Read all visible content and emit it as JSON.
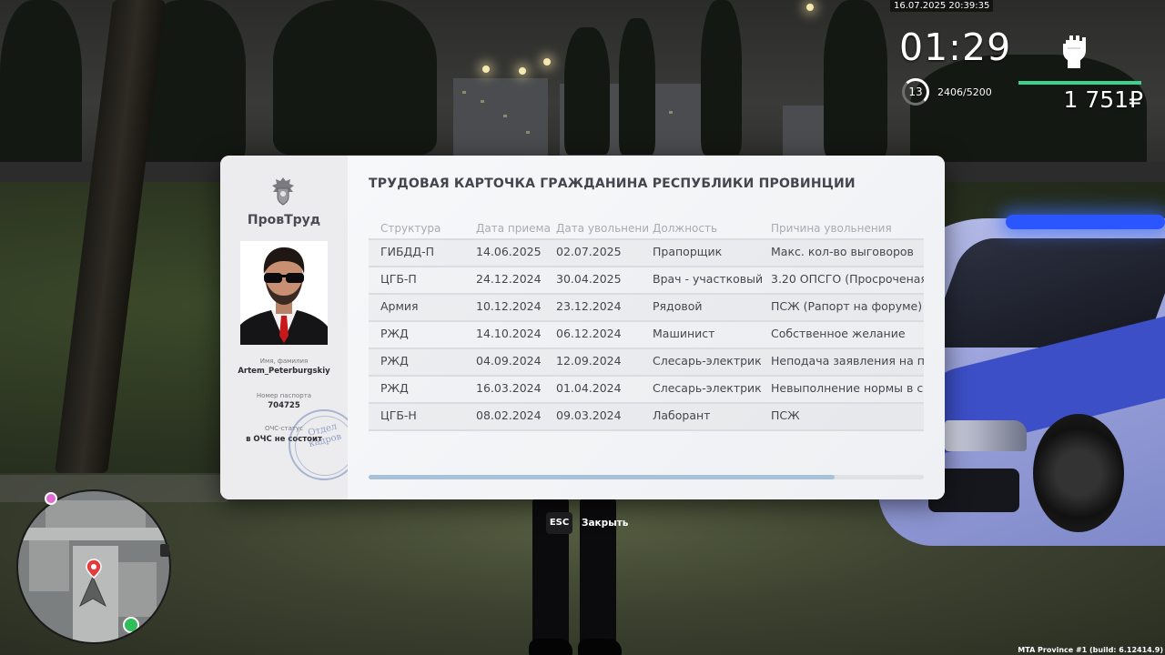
{
  "hud": {
    "datetime": "16.07.2025 20:39:35",
    "clock": "01:29",
    "level": "13",
    "xp": "2406/5200",
    "health_fraction": 1.0,
    "money": "1 751₽",
    "power_icon": "raised-fist-icon"
  },
  "card": {
    "org_name": "ПровТруд",
    "emblem_icon": "coat-of-arms-icon",
    "name_label": "Имя, фамилия",
    "name_value": "Artem_Peterburgskiy",
    "passport_label": "Номер паспорта",
    "passport_value": "704725",
    "ochs_label": "ОЧС-статус",
    "ochs_value": "в ОЧС не состоит",
    "stamp_text_1": "Отдел",
    "stamp_text_2": "кадров",
    "title": "ТРУДОВАЯ КАРТОЧКА ГРАЖДАНИНА РЕСПУБЛИКИ ПРОВИНЦИИ",
    "columns": [
      "Структура",
      "Дата приема",
      "Дата увольнени",
      "Должность",
      "Причина увольнения"
    ],
    "rows": [
      [
        "ГИБДД-П",
        "14.06.2025",
        "02.07.2025",
        "Прапорщик",
        "Макс. кол-во выговоров"
      ],
      [
        "ЦГБ-П",
        "24.12.2024",
        "30.04.2025",
        "Врач - участковый",
        "3.20 ОПСГО (Просроченая"
      ],
      [
        "Армия",
        "10.12.2024",
        "23.12.2024",
        "Рядовой",
        "ПСЖ (Рапорт на форуме)"
      ],
      [
        "РЖД",
        "14.10.2024",
        "06.12.2024",
        "Машинист",
        "Собственное желание"
      ],
      [
        "РЖД",
        "04.09.2024",
        "12.09.2024",
        "Слесарь-электрик",
        "Неподача заявления на повы"
      ],
      [
        "РЖД",
        "16.03.2024",
        "01.04.2024",
        "Слесарь-электрик",
        "Невыполнение нормы в срок"
      ],
      [
        "ЦГБ-Н",
        "08.02.2024",
        "09.03.2024",
        "Лаборант",
        "ПСЖ"
      ]
    ],
    "scroll_fraction": 0.84
  },
  "hint": {
    "key": "ESC",
    "label": "Закрыть"
  },
  "build_info": "MTA Province #1 (build: 6.12414.9)",
  "colors": {
    "health": "#3dd18d",
    "scroll_thumb": "#a9c0d9",
    "police_blue": "#3c4fc7"
  }
}
